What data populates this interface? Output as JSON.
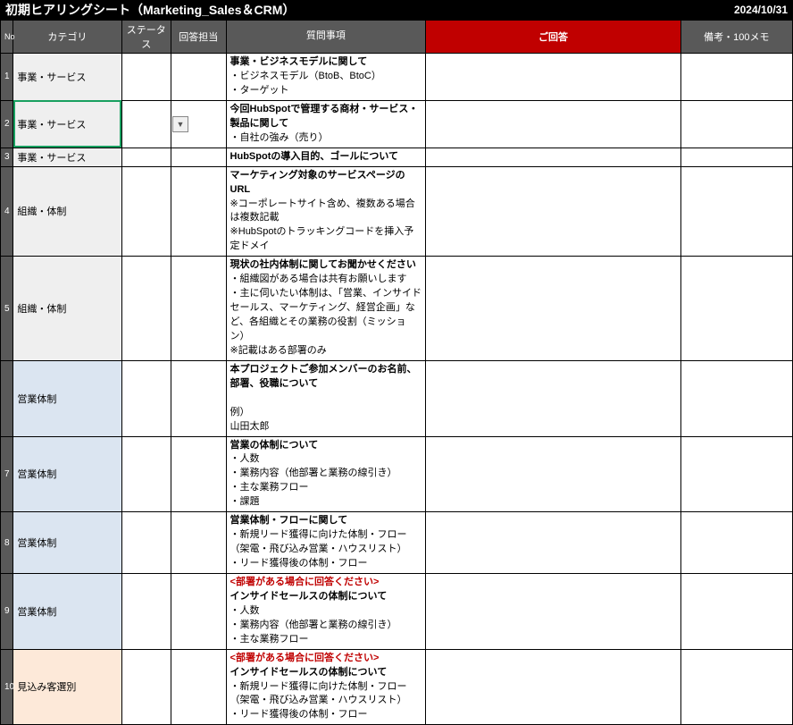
{
  "header": {
    "title": "初期ヒアリングシート（Marketing_Sales＆CRM）",
    "date": "2024/10/31"
  },
  "columns": {
    "no": "No",
    "category": "カテゴリ",
    "status": "ステータス",
    "responder": "回答担当",
    "question": "質問事項",
    "answer": "ご回答",
    "memo": "備考・100メモ"
  },
  "rows": [
    {
      "no": "1",
      "cat": "事業・サービス",
      "catClass": "bg-gray",
      "q": "<strong>事業・ビジネスモデルに関して</strong><br>・ビジネスモデル（BtoB、BtoC）<br>・ターゲット"
    },
    {
      "no": "2",
      "cat": "事業・サービス",
      "catClass": "bg-gray selected-cell",
      "selected": true,
      "q": "<strong>今回HubSpotで管理する商材・サービス・製品に関して</strong><br>・自社の強み（売り）"
    },
    {
      "no": "3",
      "cat": "事業・サービス",
      "catClass": "bg-gray",
      "q": "<strong>HubSpotの導入目的、ゴールについて</strong>"
    },
    {
      "no": "4",
      "cat": "組織・体制",
      "catClass": "bg-gray",
      "q": "<strong>マーケティング対象のサービスページのURL</strong><br>※コーポレートサイト含め、複数ある場合は複数記載<br>※HubSpotのトラッキングコードを挿入予定ドメイ"
    },
    {
      "no": "5",
      "cat": "組織・体制",
      "catClass": "bg-gray",
      "q": "<strong>現状の社内体制に関してお聞かせください</strong><br>・組織図がある場合は共有お願いします<br>・主に伺いたい体制は、「営業、インサイドセールス、マーケティング、経営企画」など、各組織とその業務の役割（ミッション）<br>※記載はある部署のみ"
    },
    {
      "no": "",
      "cat": "営業体制",
      "catClass": "bg-blue",
      "q": "<strong>本プロジェクトご参加メンバーのお名前、部署、役職について</strong><br><br>例）<br>山田太郎"
    },
    {
      "no": "7",
      "cat": "営業体制",
      "catClass": "bg-blue",
      "q": "<strong>営業の体制について</strong><br>・人数<br>・業務内容（他部署と業務の線引き）<br>・主な業務フロー<br>・課題"
    },
    {
      "no": "8",
      "cat": "営業体制",
      "catClass": "bg-blue",
      "q": "<strong>営業体制・フローに関して</strong><br>・新規リード獲得に向けた体制・フロー（架電・飛び込み営業・ハウスリスト）<br>・リード獲得後の体制・フロー"
    },
    {
      "no": "9",
      "cat": "営業体制",
      "catClass": "bg-blue",
      "q": "<span class='red'>&lt;部署がある場合に回答ください&gt;</span><br><strong>インサイドセールスの体制について</strong><br>・人数<br>・業務内容（他部署と業務の線引き）<br>・主な業務フロー"
    },
    {
      "no": "10",
      "cat": "見込み客選別",
      "catClass": "bg-orange",
      "q": "<span class='red'>&lt;部署がある場合に回答ください&gt;</span><br><strong>インサイドセールスの体制について</strong><br>・新規リード獲得に向けた体制・フロー（架電・飛び込み営業・ハウスリスト）<br>・リード獲得後の体制・フロー"
    }
  ]
}
